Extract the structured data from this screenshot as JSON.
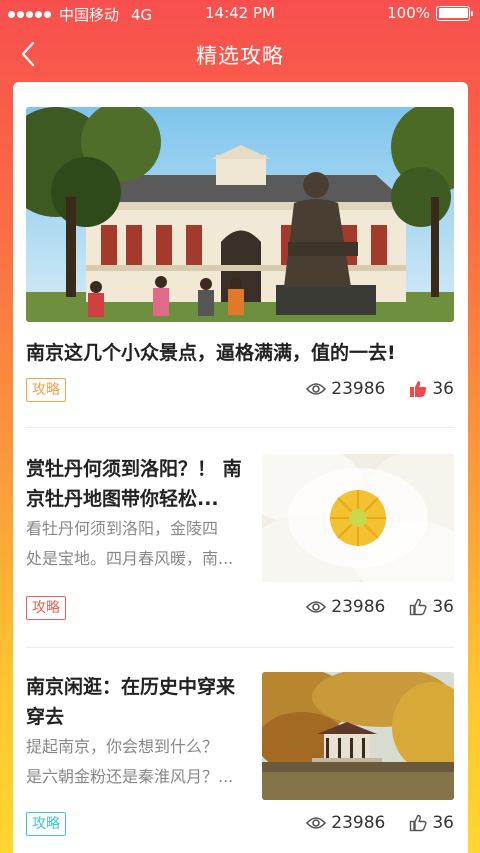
{
  "status_bar": {
    "carrier": "中国移动",
    "network": "4G",
    "time": "14:42 PM",
    "battery": "100%"
  },
  "nav": {
    "title": "精选攻略"
  },
  "feature": {
    "title": "南京这几个小众景点，逼格满满，值的一去!",
    "tag": "攻略",
    "tag_color": "#F5A04A",
    "views": "23986",
    "likes": "36",
    "liked": true
  },
  "articles": [
    {
      "title_line1": "赏牡丹何须到洛阳？！ 南",
      "title_line2": "京牡丹地图带你轻松...",
      "summary_line1": "看牡丹何须到洛阳，金陵四",
      "summary_line2": "处是宝地。四月春风暖，南...",
      "tag": "攻略",
      "tag_color": "#F25A55",
      "views": "23986",
      "likes": "36",
      "liked": false
    },
    {
      "title_line1": "南京闲逛：在历史中穿来",
      "title_line2": "穿去",
      "summary_line1": "提起南京，你会想到什么？",
      "summary_line2": "是六朝金粉还是秦淮风月？...",
      "tag": "攻略",
      "tag_color": "#3CC9C2",
      "views": "23986",
      "likes": "36",
      "liked": false
    }
  ],
  "colors": {
    "header_gradient_top": "#F84F4E",
    "background_gradient_bottom": "#FFD62E",
    "like_active": "#F24848"
  },
  "icons": [
    "back-arrow-icon",
    "eye-icon",
    "thumbs-up-icon"
  ]
}
